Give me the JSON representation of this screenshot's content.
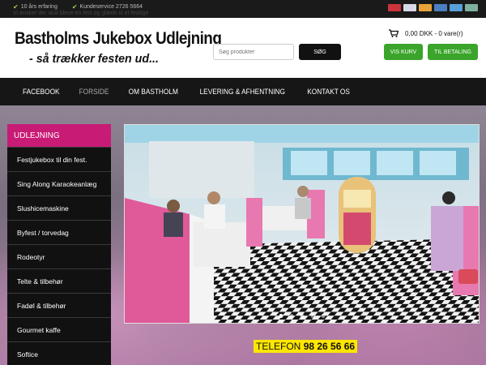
{
  "topbar": {
    "item1": "10 års erfaring",
    "item2": "Kundeservice 2726 5664",
    "ghost": "Vi ønsker der skal bleve en fest og glæde til et festlige"
  },
  "header": {
    "logo_title": "Bastholms Jukebox Udlejning",
    "logo_subtitle": "- så trækker festen ud...",
    "search_placeholder": "Søg produkter",
    "search_button": "SØG",
    "cart_summary": "0,00 DKK - 0 vare(r)",
    "view_cart": "VIS KURV",
    "checkout": "TIL BETALING"
  },
  "nav": {
    "items": [
      "FACEBOOK",
      "FORSIDE",
      "OM BASTHOLM",
      "LEVERING & AFHENTNING",
      "KONTAKT OS"
    ]
  },
  "sidebar": {
    "heading": "UDLEJNING",
    "items": [
      "Festjukebox til din fest.",
      "Sing Along Karaokeanlæg",
      "Slushicemaskine",
      "Byfest / torvedag",
      "Rodeotyr",
      "Telte & tilbehør",
      "Fadøl & tilbehør",
      "Gourmet kaffe",
      "Softice"
    ]
  },
  "banner": {
    "phone_label": "TELEFON",
    "phone_number": "98 26 56 66"
  },
  "colors": {
    "accent": "#c81b76",
    "green": "#3aa52a",
    "nav_bg": "#161616"
  }
}
